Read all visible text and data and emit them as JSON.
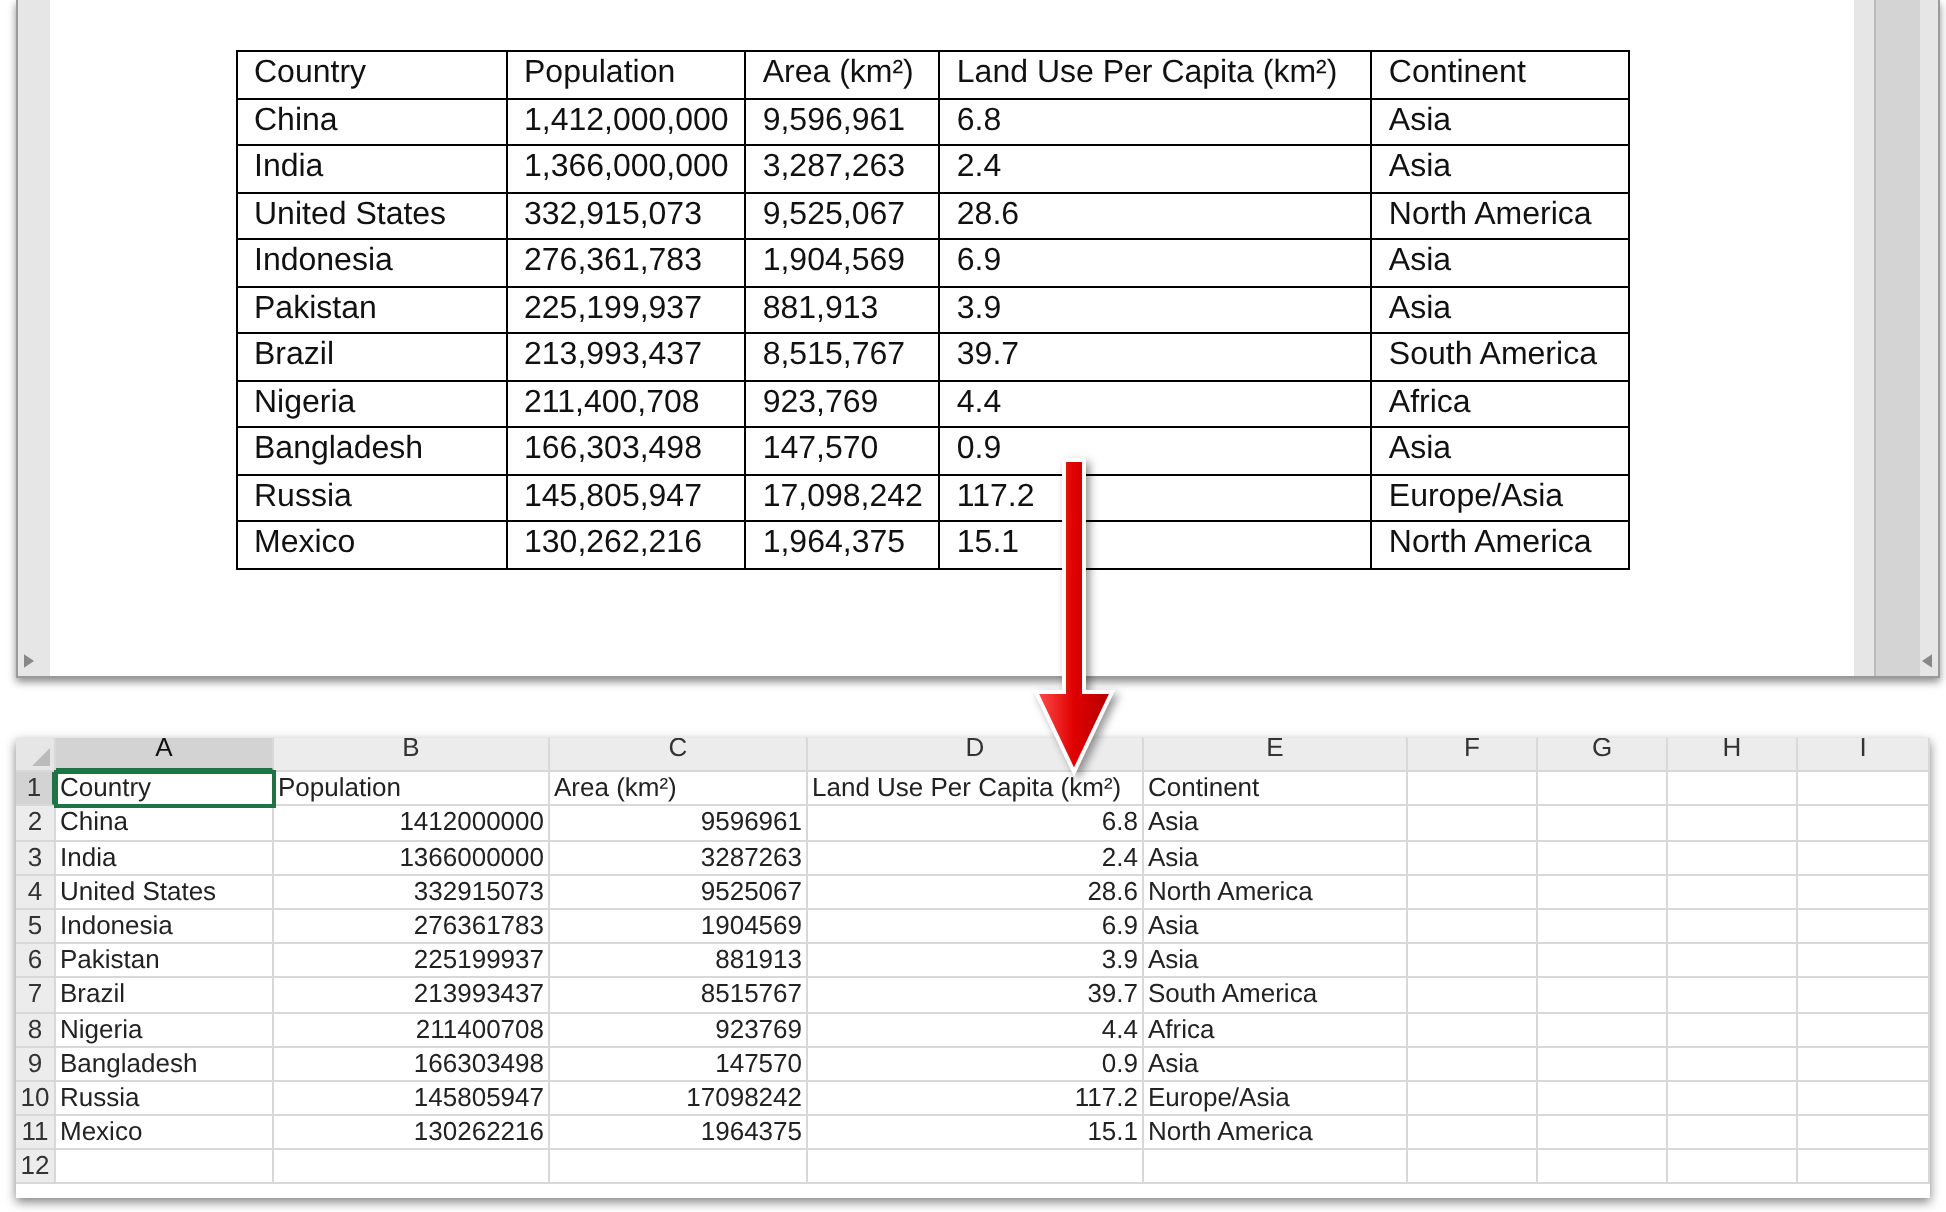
{
  "document_table": {
    "columns": [
      "Country",
      "Population",
      "Area (km²)",
      "Land Use Per Capita (km²)",
      "Continent"
    ],
    "rows": [
      [
        "China",
        "1,412,000,000",
        "9,596,961",
        "6.8",
        "Asia"
      ],
      [
        "India",
        "1,366,000,000",
        "3,287,263",
        "2.4",
        "Asia"
      ],
      [
        "United States",
        "332,915,073",
        "9,525,067",
        "28.6",
        "North America"
      ],
      [
        "Indonesia",
        "276,361,783",
        "1,904,569",
        "6.9",
        "Asia"
      ],
      [
        "Pakistan",
        "225,199,937",
        "881,913",
        "3.9",
        "Asia"
      ],
      [
        "Brazil",
        "213,993,437",
        "8,515,767",
        "39.7",
        "South America"
      ],
      [
        "Nigeria",
        "211,400,708",
        "923,769",
        "4.4",
        "Africa"
      ],
      [
        "Bangladesh",
        "166,303,498",
        "147,570",
        "0.9",
        "Asia"
      ],
      [
        "Russia",
        "145,805,947",
        "17,098,242",
        "117.2",
        "Europe/Asia"
      ],
      [
        "Mexico",
        "130,262,216",
        "1,964,375",
        "15.1",
        "North America"
      ]
    ]
  },
  "spreadsheet": {
    "columns": [
      {
        "label": "A",
        "selected": true
      },
      {
        "label": "B",
        "selected": false
      },
      {
        "label": "C",
        "selected": false
      },
      {
        "label": "D",
        "selected": false
      },
      {
        "label": "E",
        "selected": false
      },
      {
        "label": "F",
        "selected": false
      },
      {
        "label": "G",
        "selected": false
      },
      {
        "label": "H",
        "selected": false
      },
      {
        "label": "I",
        "selected": false
      }
    ],
    "rows": [
      {
        "number": "1",
        "selected": true,
        "cells": [
          {
            "kind": "text",
            "text": "Country"
          },
          {
            "kind": "text",
            "text": "Population"
          },
          {
            "kind": "text",
            "text": "Area (km²)"
          },
          {
            "kind": "text",
            "text": "Land Use Per Capita (km²)"
          },
          {
            "kind": "text",
            "text": "Continent"
          }
        ]
      },
      {
        "number": "2",
        "selected": false,
        "cells": [
          {
            "kind": "text",
            "text": "China"
          },
          {
            "kind": "number",
            "text": "1412000000"
          },
          {
            "kind": "number",
            "text": "9596961"
          },
          {
            "kind": "number",
            "text": "6.8"
          },
          {
            "kind": "text",
            "text": "Asia"
          }
        ]
      },
      {
        "number": "3",
        "selected": false,
        "cells": [
          {
            "kind": "text",
            "text": "India"
          },
          {
            "kind": "number",
            "text": "1366000000"
          },
          {
            "kind": "number",
            "text": "3287263"
          },
          {
            "kind": "number",
            "text": "2.4"
          },
          {
            "kind": "text",
            "text": "Asia"
          }
        ]
      },
      {
        "number": "4",
        "selected": false,
        "cells": [
          {
            "kind": "text",
            "text": "United States"
          },
          {
            "kind": "number",
            "text": "332915073"
          },
          {
            "kind": "number",
            "text": "9525067"
          },
          {
            "kind": "number",
            "text": "28.6"
          },
          {
            "kind": "text",
            "text": "North America"
          }
        ]
      },
      {
        "number": "5",
        "selected": false,
        "cells": [
          {
            "kind": "text",
            "text": "Indonesia"
          },
          {
            "kind": "number",
            "text": "276361783"
          },
          {
            "kind": "number",
            "text": "1904569"
          },
          {
            "kind": "number",
            "text": "6.9"
          },
          {
            "kind": "text",
            "text": "Asia"
          }
        ]
      },
      {
        "number": "6",
        "selected": false,
        "cells": [
          {
            "kind": "text",
            "text": "Pakistan"
          },
          {
            "kind": "number",
            "text": "225199937"
          },
          {
            "kind": "number",
            "text": "881913"
          },
          {
            "kind": "number",
            "text": "3.9"
          },
          {
            "kind": "text",
            "text": "Asia"
          }
        ]
      },
      {
        "number": "7",
        "selected": false,
        "cells": [
          {
            "kind": "text",
            "text": "Brazil"
          },
          {
            "kind": "number",
            "text": "213993437"
          },
          {
            "kind": "number",
            "text": "8515767"
          },
          {
            "kind": "number",
            "text": "39.7"
          },
          {
            "kind": "text",
            "text": "South America"
          }
        ]
      },
      {
        "number": "8",
        "selected": false,
        "cells": [
          {
            "kind": "text",
            "text": "Nigeria"
          },
          {
            "kind": "number",
            "text": "211400708"
          },
          {
            "kind": "number",
            "text": "923769"
          },
          {
            "kind": "number",
            "text": "4.4"
          },
          {
            "kind": "text",
            "text": "Africa"
          }
        ]
      },
      {
        "number": "9",
        "selected": false,
        "cells": [
          {
            "kind": "text",
            "text": "Bangladesh"
          },
          {
            "kind": "number",
            "text": "166303498"
          },
          {
            "kind": "number",
            "text": "147570"
          },
          {
            "kind": "number",
            "text": "0.9"
          },
          {
            "kind": "text",
            "text": "Asia"
          }
        ]
      },
      {
        "number": "10",
        "selected": false,
        "cells": [
          {
            "kind": "text",
            "text": "Russia"
          },
          {
            "kind": "number",
            "text": "145805947"
          },
          {
            "kind": "number",
            "text": "17098242"
          },
          {
            "kind": "number",
            "text": "117.2"
          },
          {
            "kind": "text",
            "text": "Europe/Asia"
          }
        ]
      },
      {
        "number": "11",
        "selected": false,
        "cells": [
          {
            "kind": "text",
            "text": "Mexico"
          },
          {
            "kind": "number",
            "text": "130262216"
          },
          {
            "kind": "number",
            "text": "1964375"
          },
          {
            "kind": "number",
            "text": "15.1"
          },
          {
            "kind": "text",
            "text": "North America"
          }
        ]
      },
      {
        "number": "12",
        "selected": false,
        "cells": []
      }
    ]
  }
}
